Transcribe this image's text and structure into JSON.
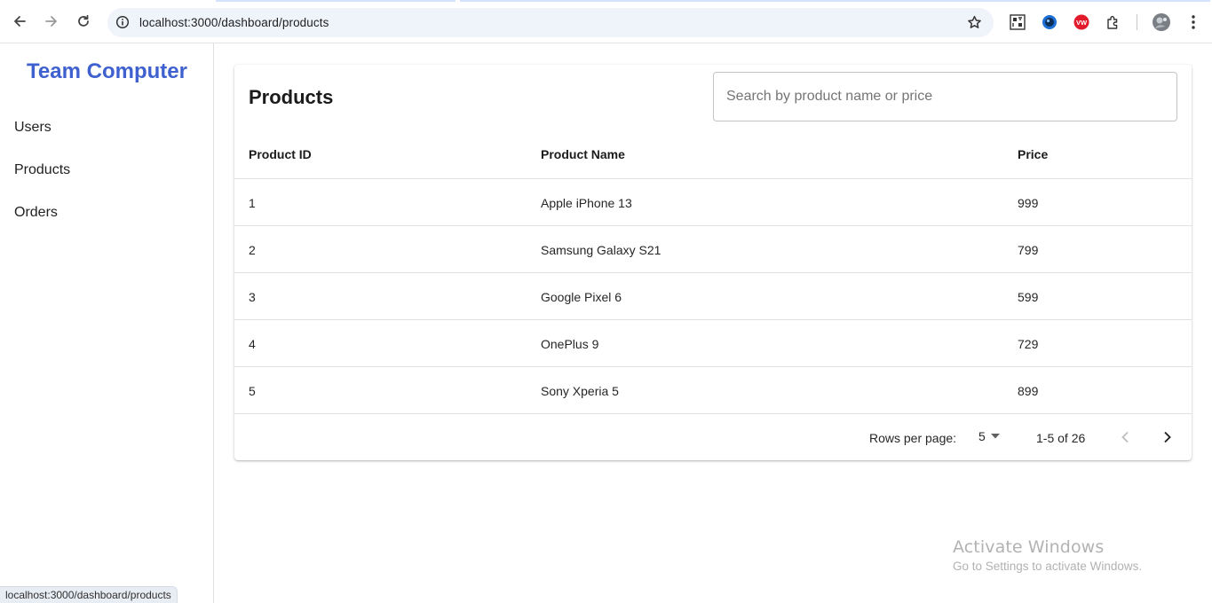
{
  "browser": {
    "url": "localhost:3000/dashboard/products",
    "icons": [
      "back-arrow-icon",
      "forward-arrow-icon",
      "reload-icon",
      "site-info-icon",
      "bookmark-star-icon",
      "qr-extension-icon",
      "blue-circle-extension-icon",
      "red-vw-extension-icon",
      "puzzle-extensions-icon",
      "profile-avatar-icon",
      "kebab-menu-icon"
    ],
    "status_url": "localhost:3000/dashboard/products"
  },
  "sidebar": {
    "brand": "Team Computer",
    "brand_color": "#3f61cf",
    "items": [
      {
        "label": "Users"
      },
      {
        "label": "Products"
      },
      {
        "label": "Orders"
      }
    ]
  },
  "products": {
    "title": "Products",
    "search_placeholder": "Search by product name or price",
    "search_value": "",
    "columns": [
      "Product ID",
      "Product Name",
      "Price"
    ],
    "rows": [
      {
        "id": "1",
        "name": "Apple iPhone 13",
        "price": "999"
      },
      {
        "id": "2",
        "name": "Samsung Galaxy S21",
        "price": "799"
      },
      {
        "id": "3",
        "name": "Google Pixel 6",
        "price": "599"
      },
      {
        "id": "4",
        "name": "OnePlus 9",
        "price": "729"
      },
      {
        "id": "5",
        "name": "Sony Xperia 5",
        "price": "899"
      }
    ],
    "pagination": {
      "rows_per_page_label": "Rows per page:",
      "rows_per_page": "5",
      "range": "1-5 of 26"
    }
  },
  "watermark": {
    "title": "Activate Windows",
    "subtitle": "Go to Settings to activate Windows."
  }
}
